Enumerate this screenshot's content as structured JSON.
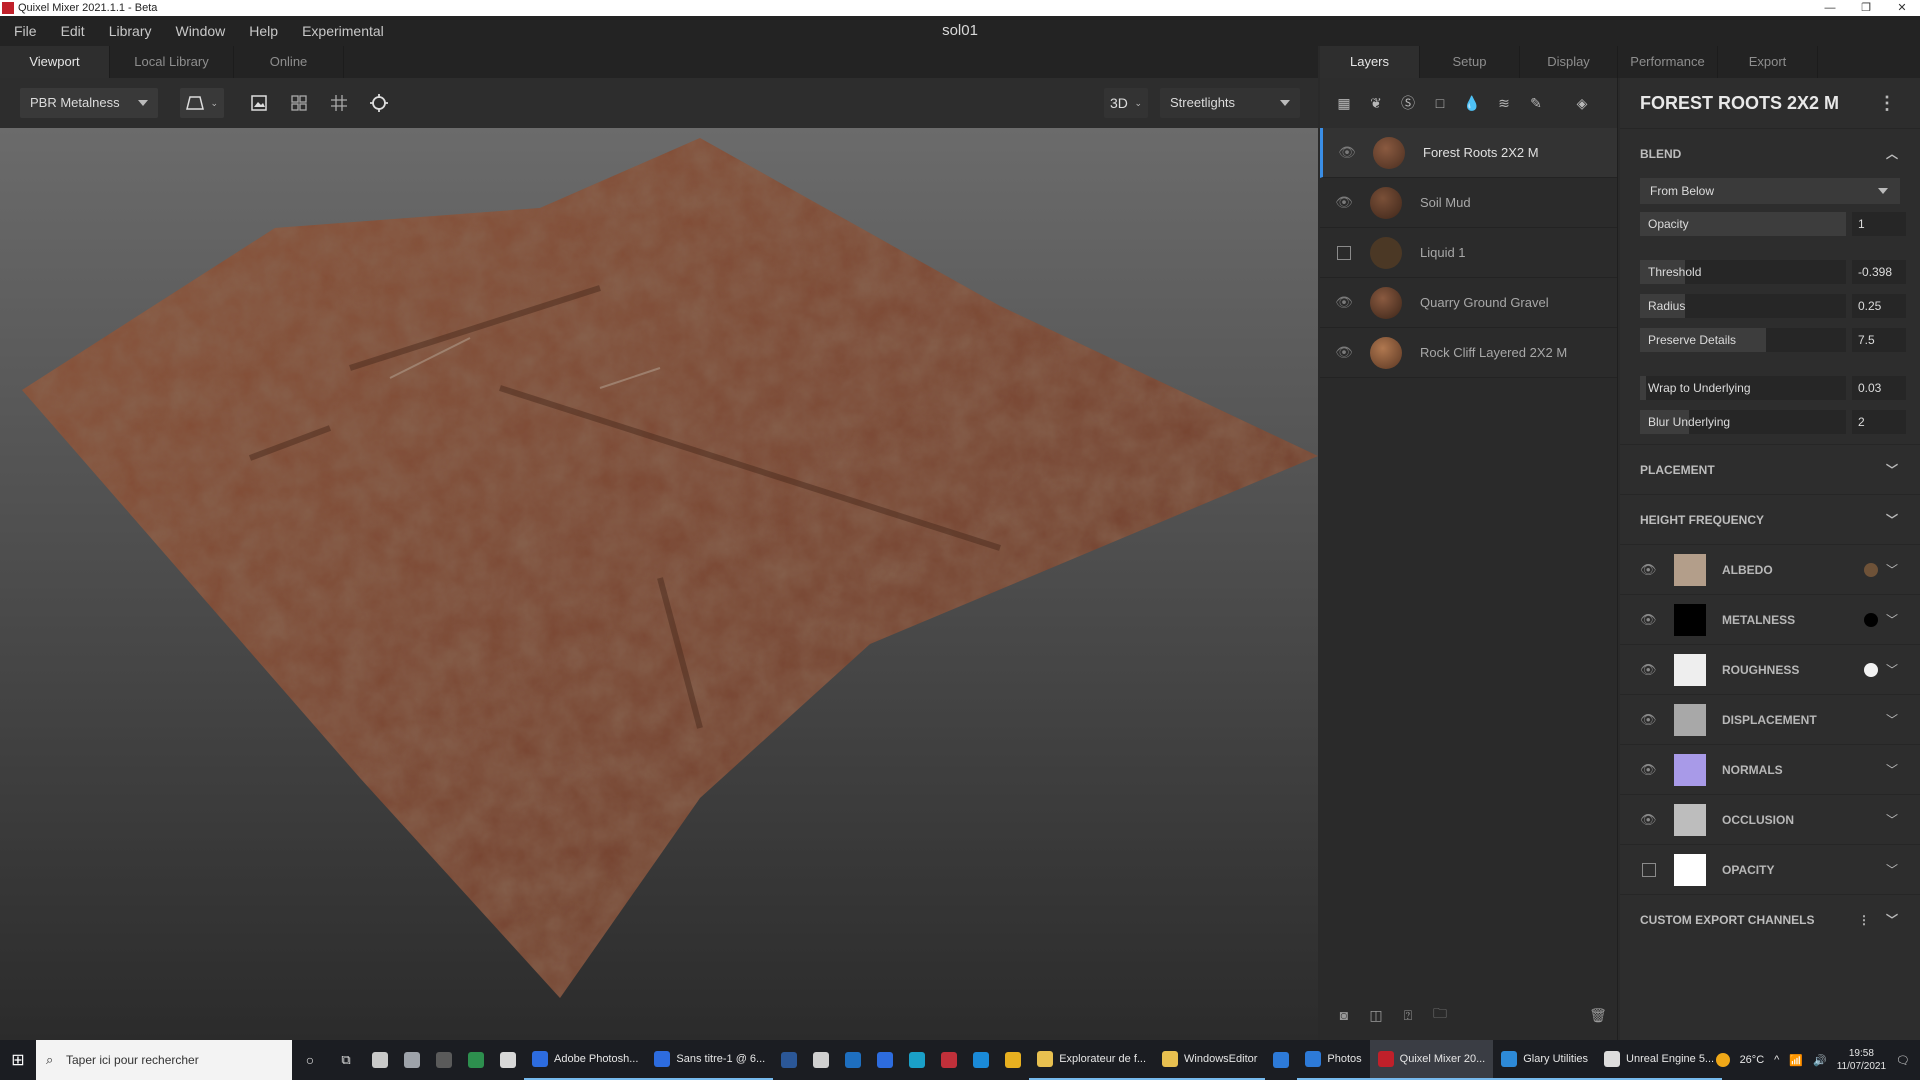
{
  "titlebar": {
    "title": "Quixel Mixer 2021.1.1 - Beta",
    "controls": [
      "—",
      "❐",
      "✕"
    ]
  },
  "menu": [
    "File",
    "Edit",
    "Library",
    "Window",
    "Help",
    "Experimental"
  ],
  "document_title": "sol01",
  "viewport_tabs": [
    "Viewport",
    "Local Library",
    "Online"
  ],
  "viewport_toolbar": {
    "shader_mode": "PBR Metalness",
    "view_mode": "3D",
    "environment": "Streetlights"
  },
  "right_tabs": [
    "Layers",
    "Setup",
    "Display",
    "Performance",
    "Export"
  ],
  "layers": [
    {
      "name": "Forest Roots 2X2 M",
      "visible": true,
      "active": true,
      "color": "#6a4530"
    },
    {
      "name": "Soil Mud",
      "visible": true,
      "active": false,
      "color": "#5a3a28"
    },
    {
      "name": "Liquid 1",
      "visible": false,
      "active": false,
      "color": "#4a3a2a"
    },
    {
      "name": "Quarry Ground Gravel",
      "visible": true,
      "active": false,
      "color": "#6b4a35"
    },
    {
      "name": "Rock Cliff Layered 2X2 M",
      "visible": true,
      "active": false,
      "color": "#8a5a3a"
    }
  ],
  "properties": {
    "title": "FOREST ROOTS 2X2 M",
    "blend": {
      "heading": "BLEND",
      "mode": "From Below",
      "opacity_label": "Opacity",
      "opacity_value": "1",
      "sliders": [
        {
          "label": "Threshold",
          "value": "-0.398",
          "fill": 0.22
        },
        {
          "label": "Radius",
          "value": "0.25",
          "fill": 0.22
        },
        {
          "label": "Preserve Details",
          "value": "7.5",
          "fill": 0.61
        }
      ],
      "sliders2": [
        {
          "label": "Wrap to Underlying",
          "value": "0.03",
          "fill": 0.03
        },
        {
          "label": "Blur Underlying",
          "value": "2",
          "fill": 0.24
        }
      ]
    },
    "placement": "PLACEMENT",
    "height_frequency": "HEIGHT FREQUENCY",
    "channels": [
      {
        "name": "ALBEDO",
        "visible": true,
        "thumb": "#b39e8a",
        "swatch": "#6e5238"
      },
      {
        "name": "METALNESS",
        "visible": true,
        "thumb": "#000000",
        "swatch": "#000000"
      },
      {
        "name": "ROUGHNESS",
        "visible": true,
        "thumb": "#eeeeee",
        "swatch": "#f2f2f2"
      },
      {
        "name": "DISPLACEMENT",
        "visible": true,
        "thumb": "#a8a8a8",
        "swatch": ""
      },
      {
        "name": "NORMALS",
        "visible": true,
        "thumb": "#a89ae8",
        "swatch": ""
      },
      {
        "name": "OCCLUSION",
        "visible": true,
        "thumb": "#bdbdbd",
        "swatch": ""
      },
      {
        "name": "OPACITY",
        "visible": false,
        "thumb": "#ffffff",
        "swatch": ""
      }
    ],
    "custom_export": "CUSTOM EXPORT CHANNELS"
  },
  "taskbar": {
    "search_placeholder": "Taper ici pour rechercher",
    "apps": [
      {
        "label": "",
        "color": "#c9c9c9"
      },
      {
        "label": "",
        "color": "#9ea3aa"
      },
      {
        "label": "",
        "color": "#5a5a5a"
      },
      {
        "label": "",
        "color": "#2d8f4e"
      },
      {
        "label": "",
        "color": "#d8d8d8"
      },
      {
        "label": "Adobe Photosh...",
        "color": "#2d6cdf"
      },
      {
        "label": "Sans titre-1 @ 6...",
        "color": "#2d6cdf"
      },
      {
        "label": "",
        "color": "#2b5797"
      },
      {
        "label": "",
        "color": "#d0d0d0"
      },
      {
        "label": "",
        "color": "#1e6fc0"
      },
      {
        "label": "",
        "color": "#2d6cdf"
      },
      {
        "label": "",
        "color": "#1aa0c8"
      },
      {
        "label": "",
        "color": "#c0303a"
      },
      {
        "label": "",
        "color": "#1a8ad8"
      },
      {
        "label": "",
        "color": "#e8b020"
      },
      {
        "label": "Explorateur de f...",
        "color": "#e8c050"
      },
      {
        "label": "WindowsEditor",
        "color": "#e8c050"
      },
      {
        "label": "",
        "color": "#2d7ad8"
      },
      {
        "label": "Photos",
        "color": "#2d7ad8"
      },
      {
        "label": "Quixel Mixer 20...",
        "color": "#c0202a"
      },
      {
        "label": "Glary Utilities",
        "color": "#2d8ad8"
      },
      {
        "label": "Unreal Engine 5...",
        "color": "#dddddd"
      }
    ],
    "weather": "26°C",
    "time": "19:58",
    "date": "11/07/2021"
  }
}
